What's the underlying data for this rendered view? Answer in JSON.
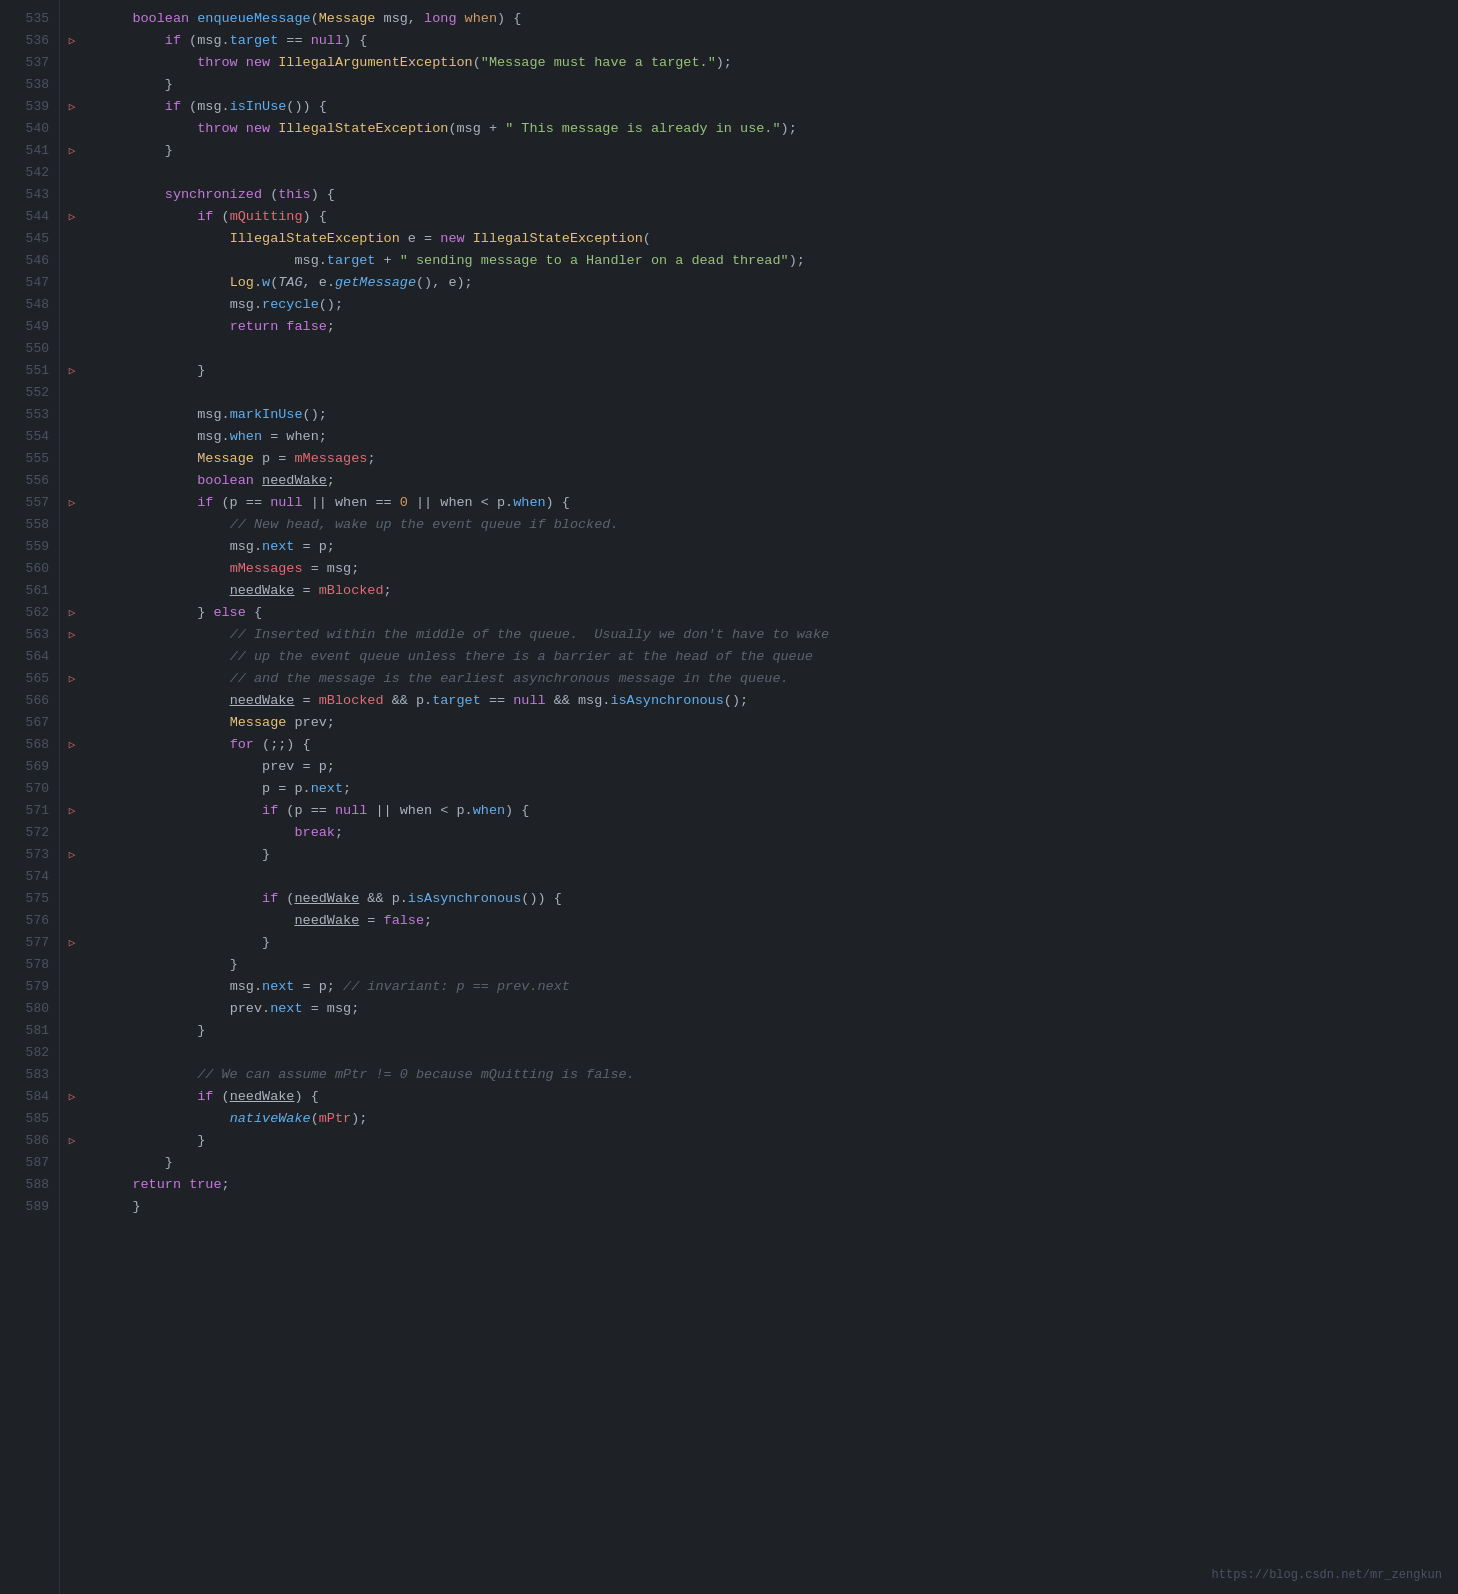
{
  "watermark": "https://blog.csdn.net/mr_zengkun",
  "lines": [
    {
      "num": "535",
      "gutter": "",
      "indent": 1,
      "tokens": [
        {
          "t": "kw",
          "v": "boolean "
        },
        {
          "t": "fn",
          "v": "enqueueMessage"
        },
        {
          "t": "plain",
          "v": "("
        },
        {
          "t": "type",
          "v": "Message"
        },
        {
          "t": "plain",
          "v": " msg, "
        },
        {
          "t": "kw",
          "v": "long"
        },
        {
          "t": "plain",
          "v": " "
        },
        {
          "t": "param",
          "v": "when"
        },
        {
          "t": "plain",
          "v": ") {"
        }
      ]
    },
    {
      "num": "536",
      "gutter": "▷",
      "indent": 2,
      "tokens": [
        {
          "t": "kw",
          "v": "if"
        },
        {
          "t": "plain",
          "v": " (msg."
        },
        {
          "t": "prop",
          "v": "target"
        },
        {
          "t": "plain",
          "v": " == "
        },
        {
          "t": "kw",
          "v": "null"
        },
        {
          "t": "plain",
          "v": ") {"
        }
      ]
    },
    {
      "num": "537",
      "gutter": "",
      "indent": 3,
      "tokens": [
        {
          "t": "kw",
          "v": "throw"
        },
        {
          "t": "plain",
          "v": " "
        },
        {
          "t": "kw",
          "v": "new"
        },
        {
          "t": "plain",
          "v": " "
        },
        {
          "t": "type",
          "v": "IllegalArgumentException"
        },
        {
          "t": "plain",
          "v": "("
        },
        {
          "t": "str",
          "v": "\"Message must have a target.\""
        },
        {
          "t": "plain",
          "v": ");"
        }
      ]
    },
    {
      "num": "538",
      "gutter": "",
      "indent": 2,
      "tokens": [
        {
          "t": "plain",
          "v": "}"
        }
      ]
    },
    {
      "num": "539",
      "gutter": "▷",
      "indent": 2,
      "tokens": [
        {
          "t": "kw",
          "v": "if"
        },
        {
          "t": "plain",
          "v": " (msg."
        },
        {
          "t": "fn",
          "v": "isInUse"
        },
        {
          "t": "plain",
          "v": "()) {"
        }
      ]
    },
    {
      "num": "540",
      "gutter": "",
      "indent": 3,
      "tokens": [
        {
          "t": "kw",
          "v": "throw"
        },
        {
          "t": "plain",
          "v": " "
        },
        {
          "t": "kw",
          "v": "new"
        },
        {
          "t": "plain",
          "v": " "
        },
        {
          "t": "type",
          "v": "IllegalStateException"
        },
        {
          "t": "plain",
          "v": "(msg + "
        },
        {
          "t": "str",
          "v": "\" This message is already in use.\""
        },
        {
          "t": "plain",
          "v": ");"
        }
      ]
    },
    {
      "num": "541",
      "gutter": "▷",
      "indent": 2,
      "tokens": [
        {
          "t": "plain",
          "v": "}"
        }
      ]
    },
    {
      "num": "542",
      "gutter": "",
      "indent": 0,
      "tokens": []
    },
    {
      "num": "543",
      "gutter": "",
      "indent": 2,
      "tokens": [
        {
          "t": "kw",
          "v": "synchronized"
        },
        {
          "t": "plain",
          "v": " ("
        },
        {
          "t": "kw",
          "v": "this"
        },
        {
          "t": "plain",
          "v": ") {"
        }
      ]
    },
    {
      "num": "544",
      "gutter": "▷",
      "indent": 3,
      "tokens": [
        {
          "t": "kw",
          "v": "if"
        },
        {
          "t": "plain",
          "v": " ("
        },
        {
          "t": "var",
          "v": "mQuitting"
        },
        {
          "t": "plain",
          "v": ") {"
        }
      ]
    },
    {
      "num": "545",
      "gutter": "",
      "indent": 4,
      "tokens": [
        {
          "t": "type",
          "v": "IllegalStateException"
        },
        {
          "t": "plain",
          "v": " e = "
        },
        {
          "t": "kw",
          "v": "new"
        },
        {
          "t": "plain",
          "v": " "
        },
        {
          "t": "type",
          "v": "IllegalStateException"
        },
        {
          "t": "plain",
          "v": "("
        }
      ]
    },
    {
      "num": "546",
      "gutter": "",
      "indent": 6,
      "tokens": [
        {
          "t": "plain",
          "v": "msg."
        },
        {
          "t": "prop",
          "v": "target"
        },
        {
          "t": "plain",
          "v": " + "
        },
        {
          "t": "str",
          "v": "\" sending message to a Handler on a dead thread\""
        },
        {
          "t": "plain",
          "v": ");"
        }
      ]
    },
    {
      "num": "547",
      "gutter": "",
      "indent": 4,
      "tokens": [
        {
          "t": "type",
          "v": "Log"
        },
        {
          "t": "plain",
          "v": "."
        },
        {
          "t": "fn",
          "v": "w"
        },
        {
          "t": "plain",
          "v": "("
        },
        {
          "t": "italic",
          "v": "TAG"
        },
        {
          "t": "plain",
          "v": ", e."
        },
        {
          "t": "italic-fn",
          "v": "getMessage"
        },
        {
          "t": "plain",
          "v": "(), e);"
        }
      ]
    },
    {
      "num": "548",
      "gutter": "",
      "indent": 4,
      "tokens": [
        {
          "t": "plain",
          "v": "msg."
        },
        {
          "t": "fn",
          "v": "recycle"
        },
        {
          "t": "plain",
          "v": "();"
        }
      ]
    },
    {
      "num": "549",
      "gutter": "",
      "indent": 4,
      "tokens": [
        {
          "t": "kw",
          "v": "return"
        },
        {
          "t": "plain",
          "v": " "
        },
        {
          "t": "kw",
          "v": "false"
        },
        {
          "t": "plain",
          "v": ";"
        }
      ]
    },
    {
      "num": "550",
      "gutter": "",
      "indent": 3,
      "tokens": []
    },
    {
      "num": "551",
      "gutter": "▷",
      "indent": 3,
      "tokens": [
        {
          "t": "plain",
          "v": "}"
        }
      ]
    },
    {
      "num": "552",
      "gutter": "",
      "indent": 0,
      "tokens": []
    },
    {
      "num": "553",
      "gutter": "",
      "indent": 3,
      "tokens": [
        {
          "t": "plain",
          "v": "msg."
        },
        {
          "t": "fn",
          "v": "markInUse"
        },
        {
          "t": "plain",
          "v": "();"
        }
      ]
    },
    {
      "num": "554",
      "gutter": "",
      "indent": 3,
      "tokens": [
        {
          "t": "plain",
          "v": "msg."
        },
        {
          "t": "prop",
          "v": "when"
        },
        {
          "t": "plain",
          "v": " = when;"
        }
      ]
    },
    {
      "num": "555",
      "gutter": "",
      "indent": 3,
      "tokens": [
        {
          "t": "type",
          "v": "Message"
        },
        {
          "t": "plain",
          "v": " p = "
        },
        {
          "t": "var",
          "v": "mMessages"
        },
        {
          "t": "plain",
          "v": ";"
        }
      ]
    },
    {
      "num": "556",
      "gutter": "",
      "indent": 3,
      "tokens": [
        {
          "t": "kw",
          "v": "boolean"
        },
        {
          "t": "plain",
          "v": " "
        },
        {
          "t": "underline",
          "v": "needWake"
        },
        {
          "t": "plain",
          "v": ";"
        }
      ]
    },
    {
      "num": "557",
      "gutter": "▷",
      "indent": 3,
      "tokens": [
        {
          "t": "kw",
          "v": "if"
        },
        {
          "t": "plain",
          "v": " (p == "
        },
        {
          "t": "kw",
          "v": "null"
        },
        {
          "t": "plain",
          "v": " || when == "
        },
        {
          "t": "num",
          "v": "0"
        },
        {
          "t": "plain",
          "v": " || when < p."
        },
        {
          "t": "prop",
          "v": "when"
        },
        {
          "t": "plain",
          "v": ") {"
        }
      ]
    },
    {
      "num": "558",
      "gutter": "",
      "indent": 4,
      "tokens": [
        {
          "t": "comment",
          "v": "// New head, wake up the event queue if blocked."
        }
      ]
    },
    {
      "num": "559",
      "gutter": "",
      "indent": 4,
      "tokens": [
        {
          "t": "plain",
          "v": "msg."
        },
        {
          "t": "prop",
          "v": "next"
        },
        {
          "t": "plain",
          "v": " = p;"
        }
      ]
    },
    {
      "num": "560",
      "gutter": "",
      "indent": 4,
      "tokens": [
        {
          "t": "var",
          "v": "mMessages"
        },
        {
          "t": "plain",
          "v": " = msg;"
        }
      ]
    },
    {
      "num": "561",
      "gutter": "",
      "indent": 4,
      "tokens": [
        {
          "t": "underline",
          "v": "needWake"
        },
        {
          "t": "plain",
          "v": " = "
        },
        {
          "t": "var",
          "v": "mBlocked"
        },
        {
          "t": "plain",
          "v": ";"
        }
      ]
    },
    {
      "num": "562",
      "gutter": "▷",
      "indent": 3,
      "tokens": [
        {
          "t": "plain",
          "v": "} "
        },
        {
          "t": "kw",
          "v": "else"
        },
        {
          "t": "plain",
          "v": " {"
        }
      ]
    },
    {
      "num": "563",
      "gutter": "▷",
      "indent": 4,
      "tokens": [
        {
          "t": "comment",
          "v": "// Inserted within the middle of the queue.  Usually we don't have to wake"
        }
      ]
    },
    {
      "num": "564",
      "gutter": "",
      "indent": 4,
      "tokens": [
        {
          "t": "comment",
          "v": "// up the event queue unless there is a barrier at the head of the queue"
        }
      ]
    },
    {
      "num": "565",
      "gutter": "▷",
      "indent": 4,
      "tokens": [
        {
          "t": "comment",
          "v": "// and the message is the earliest asynchronous message in the queue."
        }
      ]
    },
    {
      "num": "566",
      "gutter": "",
      "indent": 4,
      "tokens": [
        {
          "t": "underline",
          "v": "needWake"
        },
        {
          "t": "plain",
          "v": " = "
        },
        {
          "t": "var",
          "v": "mBlocked"
        },
        {
          "t": "plain",
          "v": " && p."
        },
        {
          "t": "prop",
          "v": "target"
        },
        {
          "t": "plain",
          "v": " == "
        },
        {
          "t": "kw",
          "v": "null"
        },
        {
          "t": "plain",
          "v": " && msg."
        },
        {
          "t": "fn",
          "v": "isAsynchronous"
        },
        {
          "t": "plain",
          "v": "();"
        }
      ]
    },
    {
      "num": "567",
      "gutter": "",
      "indent": 4,
      "tokens": [
        {
          "t": "type",
          "v": "Message"
        },
        {
          "t": "plain",
          "v": " prev;"
        }
      ]
    },
    {
      "num": "568",
      "gutter": "▷",
      "indent": 4,
      "tokens": [
        {
          "t": "kw",
          "v": "for"
        },
        {
          "t": "plain",
          "v": " (;;) {"
        }
      ]
    },
    {
      "num": "569",
      "gutter": "",
      "indent": 5,
      "tokens": [
        {
          "t": "plain",
          "v": "prev = p;"
        }
      ]
    },
    {
      "num": "570",
      "gutter": "",
      "indent": 5,
      "tokens": [
        {
          "t": "plain",
          "v": "p = p."
        },
        {
          "t": "prop",
          "v": "next"
        },
        {
          "t": "plain",
          "v": ";"
        }
      ]
    },
    {
      "num": "571",
      "gutter": "▷",
      "indent": 5,
      "tokens": [
        {
          "t": "kw",
          "v": "if"
        },
        {
          "t": "plain",
          "v": " (p == "
        },
        {
          "t": "kw",
          "v": "null"
        },
        {
          "t": "plain",
          "v": " || when < p."
        },
        {
          "t": "prop",
          "v": "when"
        },
        {
          "t": "plain",
          "v": ") {"
        }
      ]
    },
    {
      "num": "572",
      "gutter": "",
      "indent": 6,
      "tokens": [
        {
          "t": "kw",
          "v": "break"
        },
        {
          "t": "plain",
          "v": ";"
        }
      ]
    },
    {
      "num": "573",
      "gutter": "▷",
      "indent": 5,
      "tokens": [
        {
          "t": "plain",
          "v": "}"
        }
      ]
    },
    {
      "num": "574",
      "gutter": "",
      "indent": 0,
      "tokens": []
    },
    {
      "num": "575",
      "gutter": "",
      "indent": 5,
      "tokens": [
        {
          "t": "kw",
          "v": "if"
        },
        {
          "t": "plain",
          "v": " ("
        },
        {
          "t": "underline",
          "v": "needWake"
        },
        {
          "t": "plain",
          "v": " && p."
        },
        {
          "t": "fn",
          "v": "isAsynchronous"
        },
        {
          "t": "plain",
          "v": "()) {"
        }
      ]
    },
    {
      "num": "576",
      "gutter": "",
      "indent": 6,
      "tokens": [
        {
          "t": "underline",
          "v": "needWake"
        },
        {
          "t": "plain",
          "v": " = "
        },
        {
          "t": "kw",
          "v": "false"
        },
        {
          "t": "plain",
          "v": ";"
        }
      ]
    },
    {
      "num": "577",
      "gutter": "▷",
      "indent": 5,
      "tokens": [
        {
          "t": "plain",
          "v": "}"
        }
      ]
    },
    {
      "num": "578",
      "gutter": "",
      "indent": 4,
      "tokens": [
        {
          "t": "plain",
          "v": "}"
        }
      ]
    },
    {
      "num": "579",
      "gutter": "",
      "indent": 4,
      "tokens": [
        {
          "t": "plain",
          "v": "msg."
        },
        {
          "t": "prop",
          "v": "next"
        },
        {
          "t": "plain",
          "v": " = p; "
        },
        {
          "t": "comment",
          "v": "// invariant: p == prev.next"
        }
      ]
    },
    {
      "num": "580",
      "gutter": "",
      "indent": 4,
      "tokens": [
        {
          "t": "plain",
          "v": "prev."
        },
        {
          "t": "prop",
          "v": "next"
        },
        {
          "t": "plain",
          "v": " = msg;"
        }
      ]
    },
    {
      "num": "581",
      "gutter": "",
      "indent": 3,
      "tokens": [
        {
          "t": "plain",
          "v": "}"
        }
      ]
    },
    {
      "num": "582",
      "gutter": "",
      "indent": 0,
      "tokens": []
    },
    {
      "num": "583",
      "gutter": "",
      "indent": 3,
      "tokens": [
        {
          "t": "comment",
          "v": "// We can assume mPtr != 0 because mQuitting is false."
        }
      ]
    },
    {
      "num": "584",
      "gutter": "▷",
      "indent": 3,
      "tokens": [
        {
          "t": "kw",
          "v": "if"
        },
        {
          "t": "plain",
          "v": " ("
        },
        {
          "t": "underline",
          "v": "needWake"
        },
        {
          "t": "plain",
          "v": ") {"
        }
      ]
    },
    {
      "num": "585",
      "gutter": "",
      "indent": 4,
      "tokens": [
        {
          "t": "italic-fn",
          "v": "nativeWake"
        },
        {
          "t": "plain",
          "v": "("
        },
        {
          "t": "var",
          "v": "mPtr"
        },
        {
          "t": "plain",
          "v": ");"
        }
      ]
    },
    {
      "num": "586",
      "gutter": "▷",
      "indent": 3,
      "tokens": [
        {
          "t": "plain",
          "v": "}"
        }
      ]
    },
    {
      "num": "587",
      "gutter": "",
      "indent": 2,
      "tokens": [
        {
          "t": "plain",
          "v": "}"
        }
      ]
    },
    {
      "num": "588",
      "gutter": "",
      "indent": 1,
      "tokens": [
        {
          "t": "kw",
          "v": "return"
        },
        {
          "t": "plain",
          "v": " "
        },
        {
          "t": "kw",
          "v": "true"
        },
        {
          "t": "plain",
          "v": ";"
        }
      ]
    },
    {
      "num": "589",
      "gutter": "",
      "indent": 0,
      "tokens": [
        {
          "t": "plain",
          "v": "    }"
        }
      ]
    }
  ]
}
